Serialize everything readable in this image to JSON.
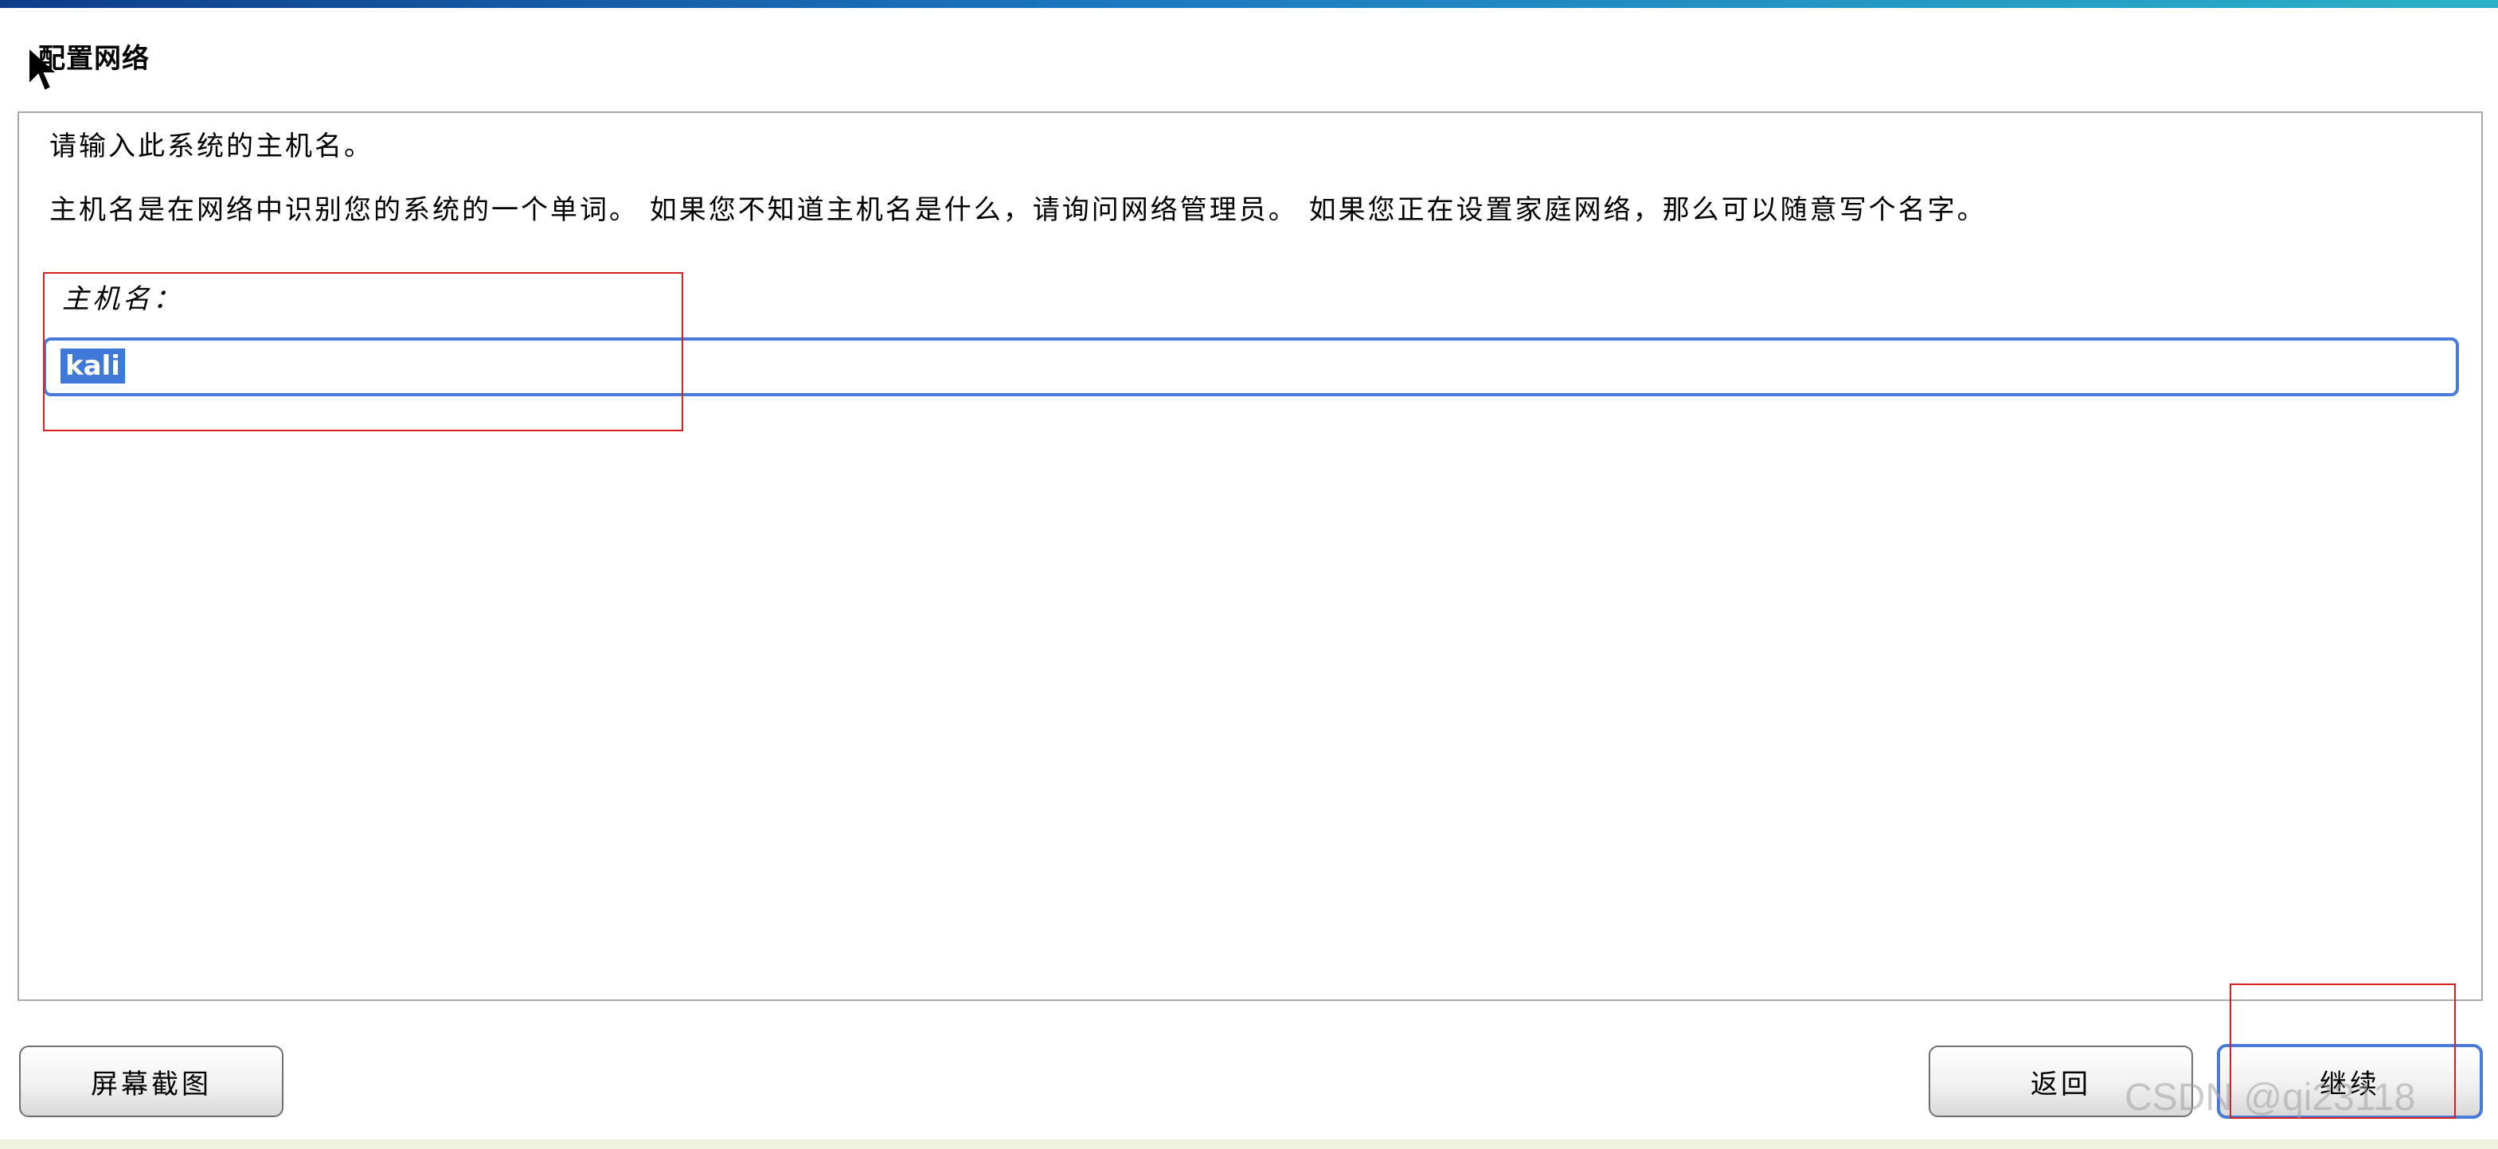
{
  "header": {
    "title": "配置网络"
  },
  "content": {
    "prompt": "请输入此系统的主机名。",
    "description": "主机名是在网络中识别您的系统的一个单词。 如果您不知道主机名是什么，请询问网络管理员。 如果您正在设置家庭网络，那么可以随意写个名字。",
    "hostname_label": "主机名：",
    "hostname_value": "kali"
  },
  "buttons": {
    "screenshot": "屏幕截图",
    "back": "返回",
    "continue": "继续"
  },
  "watermark": "CSDN @qi23118",
  "colors": {
    "accent": "#4a7bd8",
    "annotation": "#d42020",
    "selection": "#3f78d8"
  },
  "icons": {
    "cursor": "mouse-pointer-icon"
  }
}
